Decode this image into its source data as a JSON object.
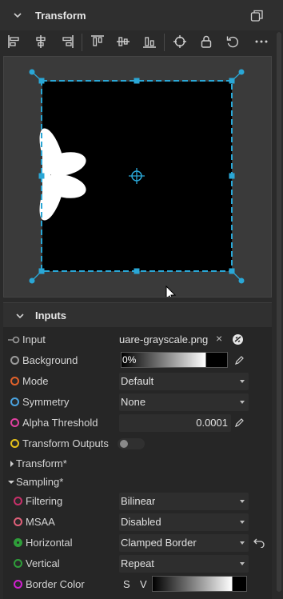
{
  "panel": {
    "title": "Transform",
    "toolbar": [
      {
        "name": "align-left-icon"
      },
      {
        "name": "align-center-h-icon"
      },
      {
        "name": "align-right-icon"
      },
      {
        "name": "align-top-icon"
      },
      {
        "name": "align-center-v-icon"
      },
      {
        "name": "align-bottom-icon"
      },
      {
        "name": "crosshair-icon"
      },
      {
        "name": "lock-icon"
      },
      {
        "name": "reset-icon"
      },
      {
        "name": "more-icon"
      }
    ]
  },
  "colors": {
    "accent": "#2aa7d6",
    "panel_bg": "#2a2a2a",
    "field_bg": "#2e2e2e"
  },
  "inputs": {
    "title": "Inputs",
    "input": {
      "label": "Input",
      "value": "uare-grayscale.png"
    },
    "background": {
      "label": "Background",
      "value": "0%"
    },
    "mode": {
      "label": "Mode",
      "value": "Default"
    },
    "symmetry": {
      "label": "Symmetry",
      "value": "None"
    },
    "alpha_threshold": {
      "label": "Alpha Threshold",
      "value": "0.0001"
    },
    "transform_outputs": {
      "label": "Transform Outputs",
      "on": false
    },
    "group_transform": "Transform*",
    "group_sampling": "Sampling*",
    "filtering": {
      "label": "Filtering",
      "value": "Bilinear"
    },
    "msaa": {
      "label": "MSAA",
      "value": "Disabled"
    },
    "horizontal": {
      "label": "Horizontal",
      "value": "Clamped Border"
    },
    "vertical": {
      "label": "Vertical",
      "value": "Repeat"
    },
    "border_color": {
      "label": "Border Color",
      "s": "S",
      "v": "V"
    }
  }
}
